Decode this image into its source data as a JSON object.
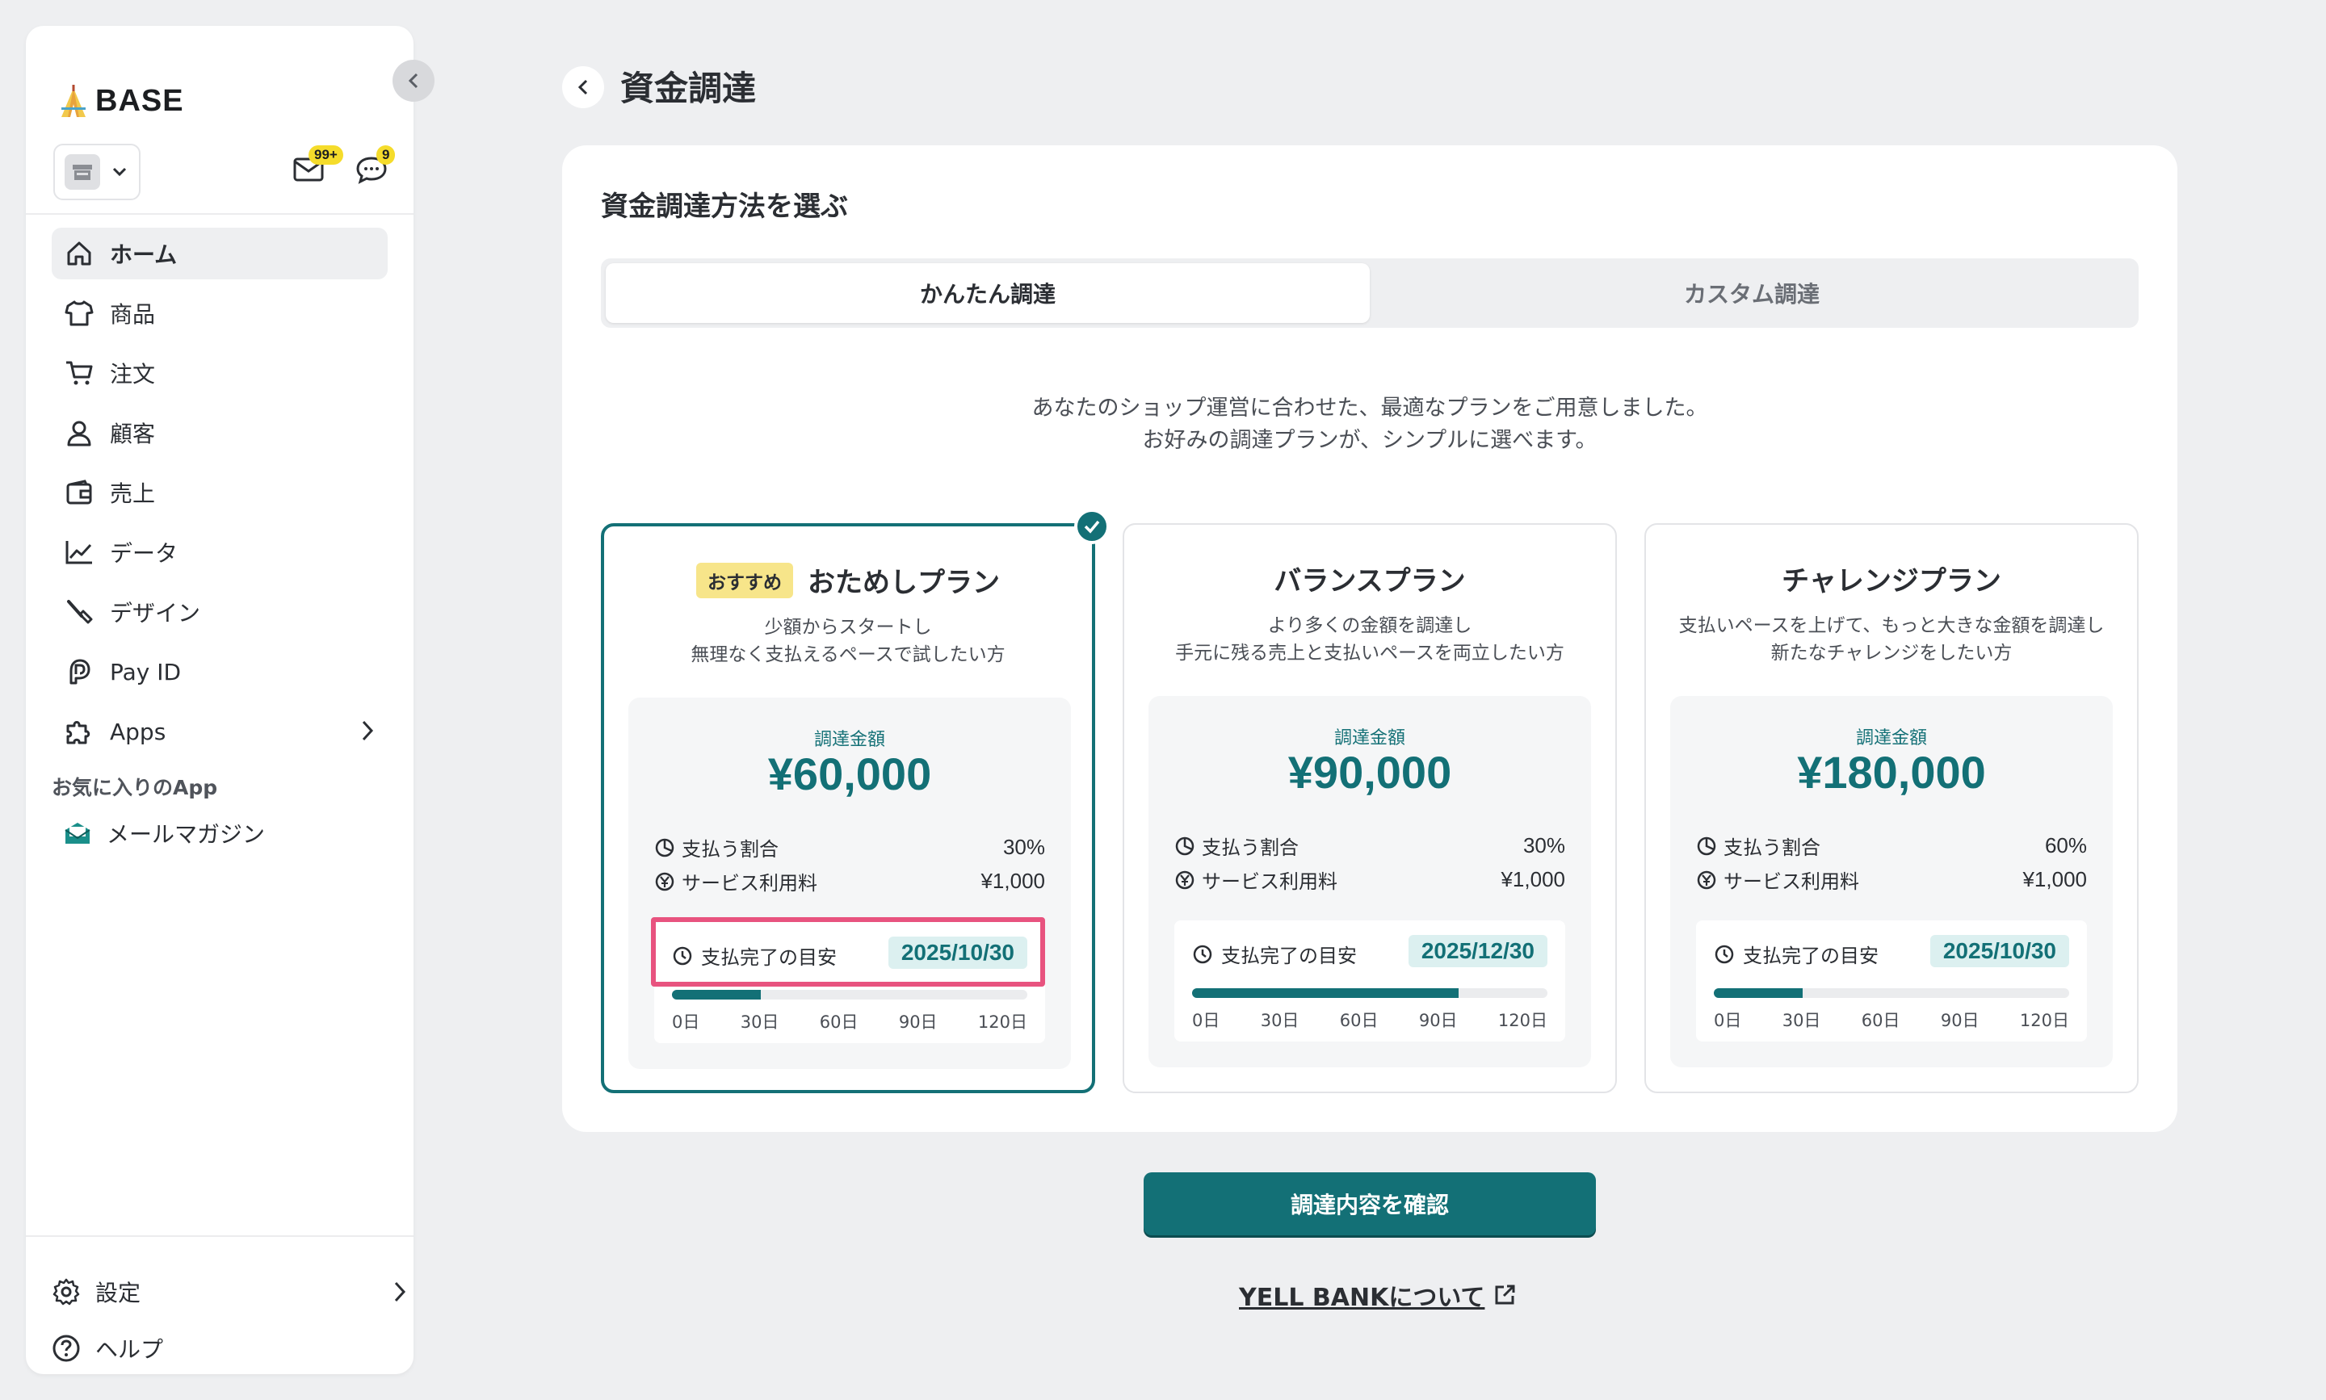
{
  "sidebar": {
    "brand": "BASE",
    "mail_badge": "99+",
    "chat_badge": "9",
    "nav": [
      {
        "label": "ホーム",
        "icon": "home-icon"
      },
      {
        "label": "商品",
        "icon": "tshirt-icon"
      },
      {
        "label": "注文",
        "icon": "cart-icon"
      },
      {
        "label": "顧客",
        "icon": "person-icon"
      },
      {
        "label": "売上",
        "icon": "wallet-icon"
      },
      {
        "label": "データ",
        "icon": "chart-line-icon"
      },
      {
        "label": "デザイン",
        "icon": "brush-icon"
      },
      {
        "label": "Pay ID",
        "icon": "payid-icon"
      },
      {
        "label": "Apps",
        "icon": "puzzle-icon"
      }
    ],
    "favorites_title": "お気に入りのApp",
    "favorite_app": "メールマガジン",
    "settings": "設定",
    "help": "ヘルプ"
  },
  "header": {
    "title": "資金調達"
  },
  "main": {
    "section_title": "資金調達方法を選ぶ",
    "tabs": [
      "かんたん調達",
      "カスタム調達"
    ],
    "intro_line1": "あなたのショップ運営に合わせた、最適なプランをご用意しました。",
    "intro_line2": "お好みの調達プランが、シンプルに選べます。",
    "common": {
      "amount_label": "調達金額",
      "rate_label": "支払う割合",
      "fee_label": "サービス利用料",
      "sched_label": "支払完了の目安",
      "ticks": [
        "0日",
        "30日",
        "60日",
        "90日",
        "120日"
      ]
    },
    "plans": [
      {
        "badge": "おすすめ",
        "title": "おためしプラン",
        "desc1": "少額からスタートし",
        "desc2": "無理なく支払えるペースで試したい方",
        "amount": "¥60,000",
        "rate": "30%",
        "fee": "¥1,000",
        "date": "2025/10/30",
        "progress": 0.25
      },
      {
        "title": "バランスプラン",
        "desc1": "より多くの金額を調達し",
        "desc2": "手元に残る売上と支払いペースを両立したい方",
        "amount": "¥90,000",
        "rate": "30%",
        "fee": "¥1,000",
        "date": "2025/12/30",
        "progress": 0.75
      },
      {
        "title": "チャレンジプラン",
        "desc1": "支払いペースを上げて、もっと大きな金額を調達し",
        "desc2": "新たなチャレンジをしたい方",
        "amount": "¥180,000",
        "rate": "60%",
        "fee": "¥1,000",
        "date": "2025/10/30",
        "progress": 0.25
      }
    ],
    "confirm_button": "調達内容を確認",
    "yell_link": "YELL BANKについて"
  },
  "colors": {
    "accent": "#137076",
    "highlight": "#e8537f",
    "badge": "#f5dc2b"
  }
}
